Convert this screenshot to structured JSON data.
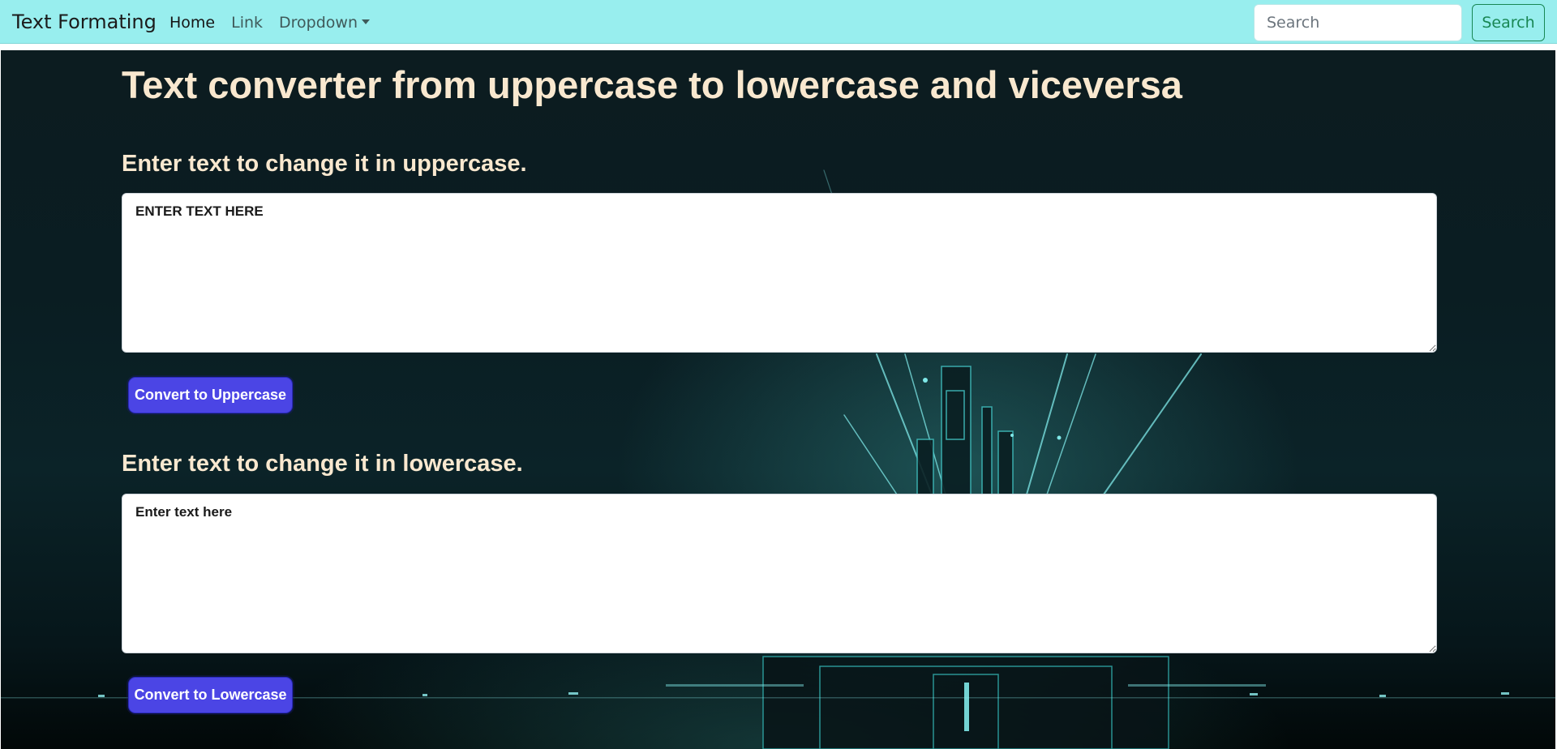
{
  "navbar": {
    "brand": "Text Formating",
    "links": [
      {
        "label": "Home"
      },
      {
        "label": "Link"
      },
      {
        "label": "Dropdown"
      }
    ],
    "search_placeholder": "Search",
    "search_button": "Search",
    "background_color": "#98eeee"
  },
  "main": {
    "title": "Text converter from uppercase to lowercase and viceversa",
    "uppercase_section": {
      "heading": "Enter text to change it in uppercase.",
      "placeholder": "ENTER TEXT HERE",
      "button": "Convert to Uppercase"
    },
    "lowercase_section": {
      "heading": "Enter text to change it in lowercase.",
      "placeholder": "Enter text here",
      "button": "Convert to Lowercase"
    }
  },
  "colors": {
    "heading_text": "#f9e8cf",
    "button_bg": "#4b45e5",
    "search_button": "#198754"
  }
}
